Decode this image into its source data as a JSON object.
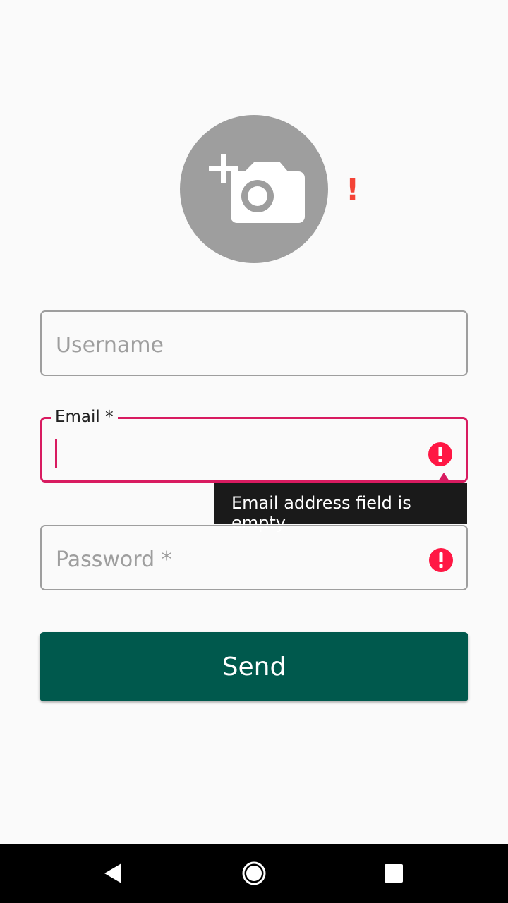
{
  "avatar": {
    "icon": "add-a-photo-icon",
    "error_mark": "!",
    "bg_color": "#9e9e9e",
    "error_color": "#f44336"
  },
  "form": {
    "username": {
      "placeholder": "Username",
      "value": ""
    },
    "email": {
      "label": "Email *",
      "value": "",
      "error": "Email address field is empty"
    },
    "password": {
      "placeholder": "Password *",
      "value": ""
    },
    "send_label": "Send"
  },
  "colors": {
    "accent": "#d81b60",
    "error_icon": "#ff1744",
    "button": "#00594d",
    "tooltip_bg": "#1a1a1a"
  },
  "navbar": {
    "back_icon": "back-triangle-icon",
    "home_icon": "home-circle-icon",
    "recents_icon": "recents-square-icon"
  }
}
